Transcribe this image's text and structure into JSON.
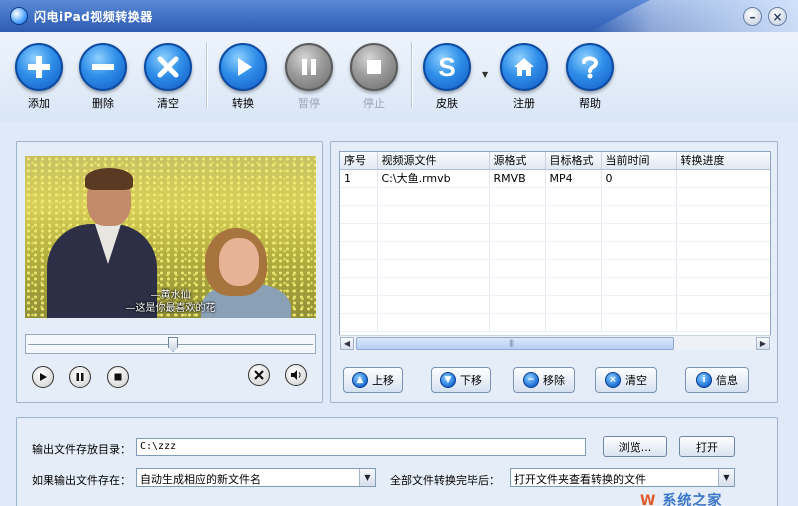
{
  "window": {
    "title": "闪电iPad视频转换器",
    "minimize_glyph": "–",
    "close_glyph": "×"
  },
  "toolbar": {
    "add": "添加",
    "delete": "删除",
    "clear": "清空",
    "convert": "转换",
    "pause": "暂停",
    "stop": "停止",
    "skin": "皮肤",
    "register": "注册",
    "help": "帮助",
    "skin_icon_letter": "S"
  },
  "preview": {
    "subtitle_line1": "—黄水仙",
    "subtitle_line2": "—这是你最喜欢的花",
    "seek_position": 0.51
  },
  "file_list": {
    "columns": [
      "序号",
      "视频源文件",
      "源格式",
      "目标格式",
      "当前时间",
      "转换进度"
    ],
    "rows": [
      {
        "index": "1",
        "source": "C:\\大鱼.rmvb",
        "src_format": "RMVB",
        "dst_format": "MP4",
        "current_time": "0",
        "progress": ""
      }
    ]
  },
  "list_buttons": {
    "up": "上移",
    "down": "下移",
    "remove": "移除",
    "clear": "清空",
    "info": "信息"
  },
  "settings": {
    "output_dir_label": "输出文件存放目录：",
    "output_dir_value": "C:\\zzz",
    "browse_label": "浏览...",
    "open_label": "打开",
    "if_exists_label": "如果输出文件存在：",
    "if_exists_value": "自动生成相应的新文件名",
    "after_all_label": "全部文件转换完毕后：",
    "after_all_value": "打开文件夹查看转换的文件"
  },
  "watermark": {
    "prefix": "W",
    "text": "系统之家"
  }
}
